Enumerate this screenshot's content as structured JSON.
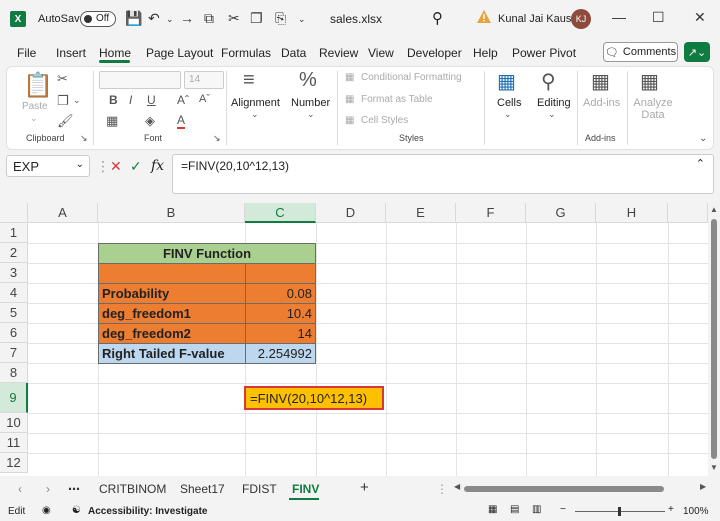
{
  "titlebar": {
    "autosave_label": "AutoSave",
    "toggle_state": "Off",
    "filename": "sales.xlsx",
    "username": "Kunal Jai Kaushik",
    "avatar_initials": "KJ"
  },
  "menu": {
    "items": [
      "File",
      "Insert",
      "Home",
      "Page Layout",
      "Formulas",
      "Data",
      "Review",
      "View",
      "Developer",
      "Help",
      "Power Pivot"
    ],
    "active": "Home",
    "comments_label": "Comments"
  },
  "ribbon": {
    "clipboard": {
      "paste": "Paste",
      "label": "Clipboard"
    },
    "font": {
      "size": "14",
      "label": "Font"
    },
    "alignment": "Alignment",
    "number": "Number",
    "styles": {
      "conditional": "Conditional Formatting",
      "format_table": "Format as Table",
      "cell_styles": "Cell Styles",
      "label": "Styles"
    },
    "cells": "Cells",
    "editing": "Editing",
    "addins": {
      "label": "Add-ins",
      "group": "Add-ins"
    },
    "analyze": "Analyze Data"
  },
  "formula_bar": {
    "name_box": "EXP",
    "fx": "fx",
    "formula": "=FINV(20,10^12,13)"
  },
  "grid": {
    "columns": [
      "A",
      "B",
      "C",
      "D",
      "E",
      "F",
      "G",
      "H"
    ],
    "rows": [
      "1",
      "2",
      "3",
      "4",
      "5",
      "6",
      "7",
      "8",
      "9",
      "10",
      "11",
      "12"
    ],
    "selected_column": "C",
    "selected_row": "9",
    "table": {
      "header": "FINV Function",
      "rows": [
        {
          "label": "Probability",
          "value": "0.08"
        },
        {
          "label": "deg_freedom1",
          "value": "10.4"
        },
        {
          "label": "deg_freedom2",
          "value": "14"
        },
        {
          "label": "Right Tailed F-value",
          "value": "2.254992"
        }
      ]
    },
    "editing_cell": "=FINV(20,10^12,13)"
  },
  "sheets": {
    "tabs": [
      "CRITBINOM",
      "Sheet17",
      "FDIST",
      "FINV"
    ],
    "active": "FINV"
  },
  "statusbar": {
    "mode": "Edit",
    "accessibility": "Accessibility: Investigate",
    "zoom": "100%"
  },
  "colors": {
    "excel_green": "#107c41",
    "orange_fill": "#ed7d31",
    "green_fill": "#a9d08e",
    "blue_fill": "#bdd7ee",
    "edit_fill": "#ffc000",
    "edit_border": "#d9383a"
  }
}
